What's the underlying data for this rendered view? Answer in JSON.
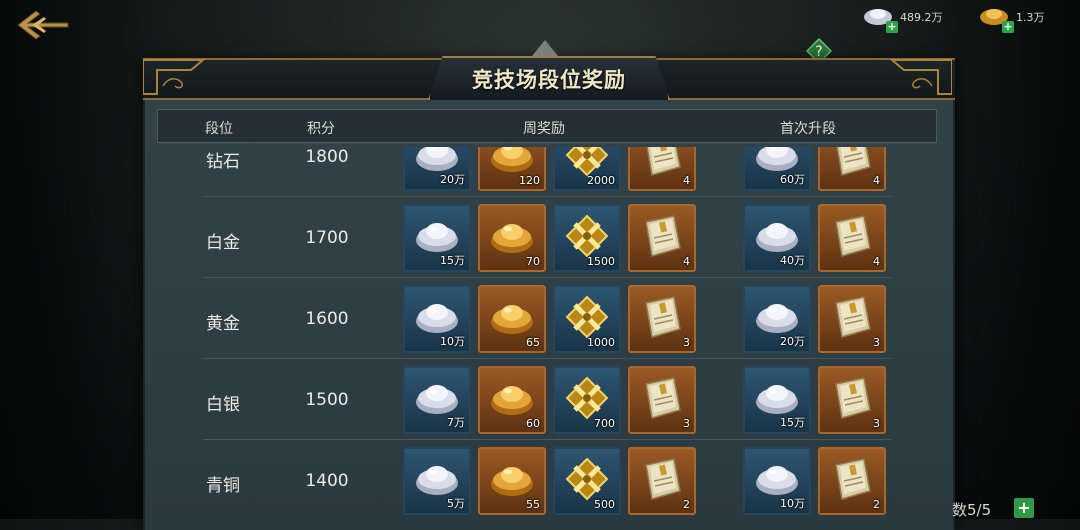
{
  "currency": {
    "silver": {
      "value": "489.2万",
      "icon": "silver-ingot-icon"
    },
    "gold": {
      "value": "1.3万",
      "icon": "gold-ingot-icon"
    }
  },
  "panel": {
    "title": "竞技场段位奖励"
  },
  "columns": {
    "rank": "段位",
    "score": "积分",
    "weekly": "周奖励",
    "first": "首次升段"
  },
  "rows": [
    {
      "rank": "钻石",
      "score": "1800",
      "weekly": [
        {
          "icon": "silver-ingot-icon",
          "qty": "20万"
        },
        {
          "icon": "gold-ingot-icon",
          "qty": "120"
        },
        {
          "icon": "crossed-swords-badge-icon",
          "qty": "2000"
        },
        {
          "icon": "scroll-book-icon",
          "qty": "4"
        }
      ],
      "first": [
        {
          "icon": "silver-ingot-icon",
          "qty": "60万"
        },
        {
          "icon": "scroll-book-icon",
          "qty": "4"
        }
      ]
    },
    {
      "rank": "白金",
      "score": "1700",
      "weekly": [
        {
          "icon": "silver-ingot-icon",
          "qty": "15万"
        },
        {
          "icon": "gold-ingot-icon",
          "qty": "70"
        },
        {
          "icon": "crossed-swords-badge-icon",
          "qty": "1500"
        },
        {
          "icon": "scroll-book-icon",
          "qty": "4"
        }
      ],
      "first": [
        {
          "icon": "silver-ingot-icon",
          "qty": "40万"
        },
        {
          "icon": "scroll-book-icon",
          "qty": "4"
        }
      ]
    },
    {
      "rank": "黄金",
      "score": "1600",
      "weekly": [
        {
          "icon": "silver-ingot-icon",
          "qty": "10万"
        },
        {
          "icon": "gold-ingot-icon",
          "qty": "65"
        },
        {
          "icon": "crossed-swords-badge-icon",
          "qty": "1000"
        },
        {
          "icon": "scroll-book-icon",
          "qty": "3"
        }
      ],
      "first": [
        {
          "icon": "silver-ingot-icon",
          "qty": "20万"
        },
        {
          "icon": "scroll-book-icon",
          "qty": "3"
        }
      ]
    },
    {
      "rank": "白银",
      "score": "1500",
      "weekly": [
        {
          "icon": "silver-ingot-icon",
          "qty": "7万"
        },
        {
          "icon": "gold-ingot-icon",
          "qty": "60"
        },
        {
          "icon": "crossed-swords-badge-icon",
          "qty": "700"
        },
        {
          "icon": "scroll-book-icon",
          "qty": "3"
        }
      ],
      "first": [
        {
          "icon": "silver-ingot-icon",
          "qty": "15万"
        },
        {
          "icon": "scroll-book-icon",
          "qty": "3"
        }
      ]
    },
    {
      "rank": "青铜",
      "score": "1400",
      "weekly": [
        {
          "icon": "silver-ingot-icon",
          "qty": "5万"
        },
        {
          "icon": "gold-ingot-icon",
          "qty": "55"
        },
        {
          "icon": "crossed-swords-badge-icon",
          "qty": "500"
        },
        {
          "icon": "scroll-book-icon",
          "qty": "2"
        }
      ],
      "first": [
        {
          "icon": "silver-ingot-icon",
          "qty": "10万"
        },
        {
          "icon": "scroll-book-icon",
          "qty": "2"
        }
      ]
    }
  ],
  "footer": {
    "count": "数5/5",
    "plus": "+"
  }
}
